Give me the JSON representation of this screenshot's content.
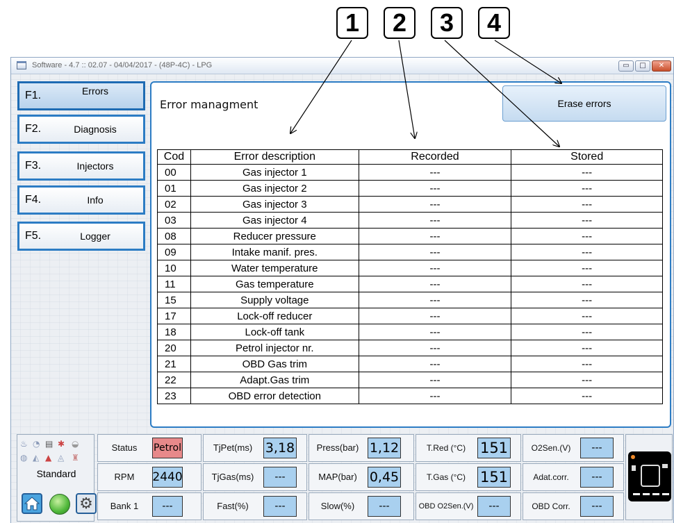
{
  "callouts": [
    "1",
    "2",
    "3",
    "4"
  ],
  "window": {
    "title": "Software - 4.7 :: 02.07 - 04/04/2017 - (48P-4C) - LPG",
    "controls": {
      "minimize": "▭",
      "maximize": "□",
      "close": "✕"
    }
  },
  "sidebar": {
    "items": [
      {
        "key": "F1.",
        "label": "Errors",
        "active": true
      },
      {
        "key": "F2.",
        "label": "Diagnosis",
        "active": false
      },
      {
        "key": "F3.",
        "label": "Injectors",
        "active": false
      },
      {
        "key": "F4.",
        "label": "Info",
        "active": false
      },
      {
        "key": "F5.",
        "label": "Logger",
        "active": false
      }
    ]
  },
  "panel": {
    "title": "Error managment",
    "erase_button": "Erase errors"
  },
  "error_table": {
    "headers": [
      "Cod",
      "Error description",
      "Recorded",
      "Stored"
    ],
    "rows": [
      [
        "00",
        "Gas injector 1",
        "---",
        "---"
      ],
      [
        "01",
        "Gas injector 2",
        "---",
        "---"
      ],
      [
        "02",
        "Gas injector 3",
        "---",
        "---"
      ],
      [
        "03",
        "Gas injector 4",
        "---",
        "---"
      ],
      [
        "08",
        "Reducer pressure",
        "---",
        "---"
      ],
      [
        "09",
        "Intake manif. pres.",
        "---",
        "---"
      ],
      [
        "10",
        "Water temperature",
        "---",
        "---"
      ],
      [
        "11",
        "Gas temperature",
        "---",
        "---"
      ],
      [
        "15",
        "Supply voltage",
        "---",
        "---"
      ],
      [
        "17",
        "Lock-off reducer",
        "---",
        "---"
      ],
      [
        "18",
        "Lock-off tank",
        "---",
        "---"
      ],
      [
        "20",
        "Petrol injector nr.",
        "---",
        "---"
      ],
      [
        "21",
        "OBD Gas trim",
        "---",
        "---"
      ],
      [
        "22",
        "Adapt.Gas trim",
        "---",
        "---"
      ],
      [
        "23",
        "OBD error detection",
        "---",
        "---"
      ]
    ]
  },
  "status_strip": {
    "mode_label": "Standard",
    "icons": {
      "home": "home-icon",
      "status_led": "green-led-icon",
      "settings": "gear-icon",
      "gauge": "fuel-gauge-icon"
    },
    "accent_colors": {
      "value_box": "#a9d0ef",
      "petrol_box": "#e7898a",
      "button_border": "#2c7cc4"
    },
    "fields": [
      {
        "id": "status",
        "label": "Status",
        "value": "Petrol"
      },
      {
        "id": "rpm",
        "label": "RPM",
        "value": "2440"
      },
      {
        "id": "bank",
        "label": "Bank 1",
        "value": "---"
      },
      {
        "id": "tjpet",
        "label": "TjPet(ms)",
        "value": "3,18"
      },
      {
        "id": "tjgas",
        "label": "TjGas(ms)",
        "value": "---"
      },
      {
        "id": "fast",
        "label": "Fast(%)",
        "value": "---"
      },
      {
        "id": "press",
        "label": "Press(bar)",
        "value": "1,12"
      },
      {
        "id": "map",
        "label": "MAP(bar)",
        "value": "0,45"
      },
      {
        "id": "slow",
        "label": "Slow(%)",
        "value": "---"
      },
      {
        "id": "tred",
        "label": "T.Red (°C)",
        "value": "151"
      },
      {
        "id": "tgas",
        "label": "T.Gas (°C)",
        "value": "151"
      },
      {
        "id": "obdo2",
        "label": "OBD O2Sen.(V)",
        "value": "---"
      },
      {
        "id": "o2sen",
        "label": "O2Sen.(V)",
        "value": "---"
      },
      {
        "id": "adat",
        "label": "Adat.corr.",
        "value": "---"
      },
      {
        "id": "obdcorr",
        "label": "OBD Corr.",
        "value": "---"
      }
    ]
  }
}
